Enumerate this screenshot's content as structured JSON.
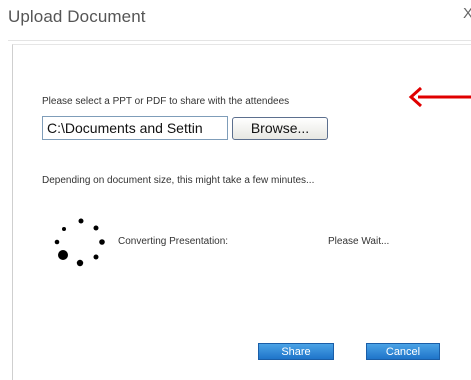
{
  "dialog": {
    "title": "Upload Document",
    "close_glyph": "X"
  },
  "upload": {
    "prompt": "Please select a PPT or PDF to share with the attendees",
    "file_path": "C:\\Documents and Settin",
    "browse_label": "Browse..."
  },
  "note": "Depending on document size, this might take a few minutes...",
  "status": {
    "label": "Converting Presentation:",
    "value": "Please Wait..."
  },
  "buttons": {
    "share": "Share",
    "cancel": "Cancel"
  },
  "icons": {
    "close": "close-icon",
    "arrow": "arrow-left-icon",
    "spinner": "loading-spinner-icon"
  },
  "colors": {
    "arrow": "#e00000",
    "button": "#2b86d8"
  }
}
